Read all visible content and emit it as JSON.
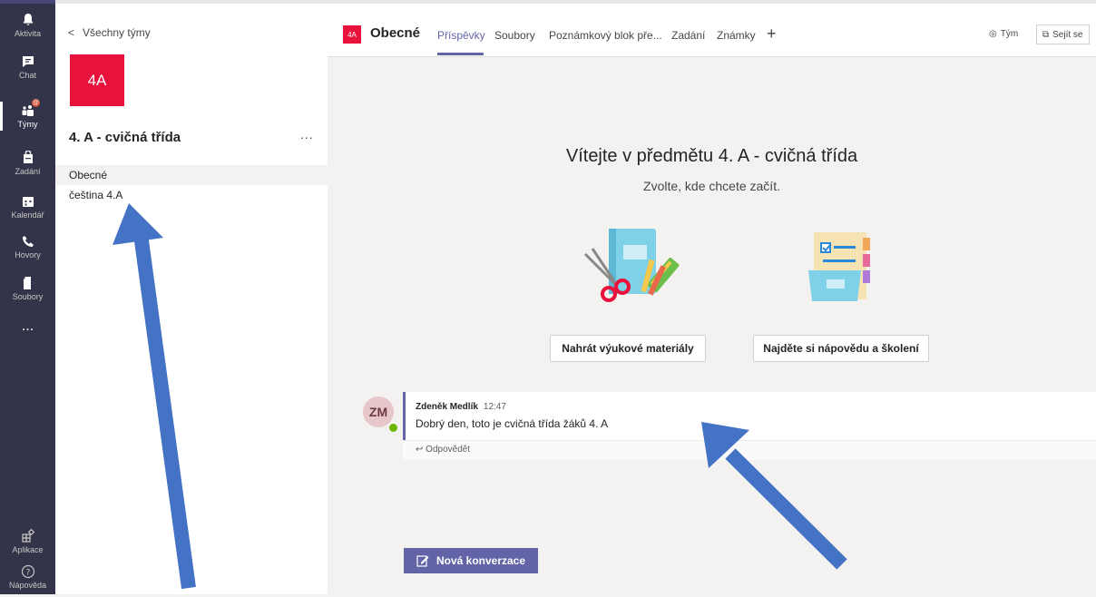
{
  "rail": {
    "items": [
      {
        "label": "Aktivita",
        "icon": "bell-icon"
      },
      {
        "label": "Chat",
        "icon": "chat-icon"
      },
      {
        "label": "Týmy",
        "icon": "teams-icon"
      },
      {
        "label": "Zadání",
        "icon": "assignments-icon"
      },
      {
        "label": "Kalendář",
        "icon": "calendar-icon"
      },
      {
        "label": "Hovory",
        "icon": "phone-icon"
      },
      {
        "label": "Soubory",
        "icon": "files-icon"
      }
    ],
    "more": "...",
    "apps_label": "Aplikace",
    "help_label": "Nápověda",
    "teams_badge": "@"
  },
  "panel": {
    "back_label": "Všechny týmy",
    "team_avatar": "4A",
    "team_name": "4. A - cvičná třída",
    "more": "...",
    "channels": [
      {
        "label": "Obecné"
      },
      {
        "label": "čeština 4.A"
      }
    ]
  },
  "header": {
    "channel_avatar": "4A",
    "channel_name": "Obecné",
    "tabs": [
      {
        "label": "Příspěvky"
      },
      {
        "label": "Soubory"
      },
      {
        "label": "Poznámkový blok pře..."
      },
      {
        "label": "Zadání"
      },
      {
        "label": "Známky"
      }
    ],
    "add_tab": "+",
    "team_button": "Tým",
    "meet_button": "Sejít se"
  },
  "welcome": {
    "title": "Vítejte v předmětu 4. A - cvičná třída",
    "subtitle": "Zvolte, kde chcete začít.",
    "upload_button": "Nahrát výukové materiály",
    "help_button": "Najděte si nápovědu a školení"
  },
  "message": {
    "avatar_initials": "ZM",
    "author": "Zdeněk Medlík",
    "time": "12:47",
    "body": "Dobrý den, toto je cvičná třída žáků 4. A",
    "reply_label": "Odpovědět"
  },
  "compose": {
    "new_conversation": "Nová konverzace"
  },
  "colors": {
    "rail_bg": "#33344a",
    "accent": "#6264a7",
    "team_red": "#e8123c",
    "arrow_blue": "#4472c4"
  }
}
